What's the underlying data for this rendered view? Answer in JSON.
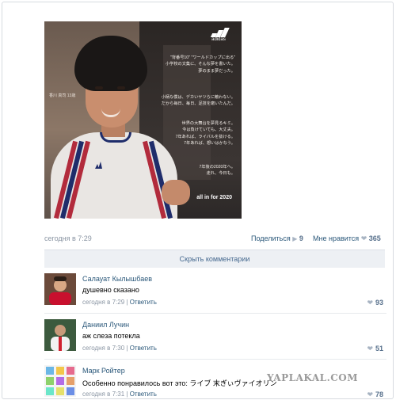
{
  "post": {
    "image": {
      "logo_text": "adidas",
      "left_caption": "香川 真司 13歳",
      "jp_lines_1": [
        "\"背番号10\" \"ワールドカップに出る\"",
        "小学校の文集に、そんな夢を書いた。",
        "夢のまま夢だった。"
      ],
      "jp_lines_2": [
        "小柄な僕は、デカいヤツらに敵わない。",
        "だから毎日、毎日、足技を磨いたんだ。"
      ],
      "jp_lines_3": [
        "世界の大舞台を夢見るキミ。",
        "今は負けていても、大丈夫。",
        "7年あれば、ライバルを抜ける。",
        "7年あれば、想いはかなう。"
      ],
      "jp_lines_4": [
        "7年後の2020年へ。",
        "走れ、今日も。"
      ],
      "slogan": "all in for 2020"
    },
    "date": "сегодня в 7:29",
    "share_label": "Поделиться",
    "share_count": "9",
    "like_label": "Мне нравится",
    "like_count": "365",
    "hide_comments_label": "Скрыть комментарии"
  },
  "comments": [
    {
      "author": "Салауат Кылышбаев",
      "text": "душевно сказано",
      "date": "сегодня в 7:29",
      "reply_label": "Ответить",
      "likes": "93"
    },
    {
      "author": "Даниил Лучин",
      "text": "аж слеза потекла",
      "date": "сегодня в 7:30",
      "reply_label": "Ответить",
      "likes": "51"
    },
    {
      "author": "Марк Ройтер",
      "text": "Особенно понравилось вот это: ライブ 末ぎぃヴァイオリン",
      "date": "сегодня в 7:31",
      "reply_label": "Ответить",
      "likes": "78"
    }
  ],
  "watermark": "YAPLAKAL.COM",
  "colors": {
    "link": "#2b587a",
    "meta": "#8a95a3",
    "bar_bg": "#edf0f4"
  }
}
